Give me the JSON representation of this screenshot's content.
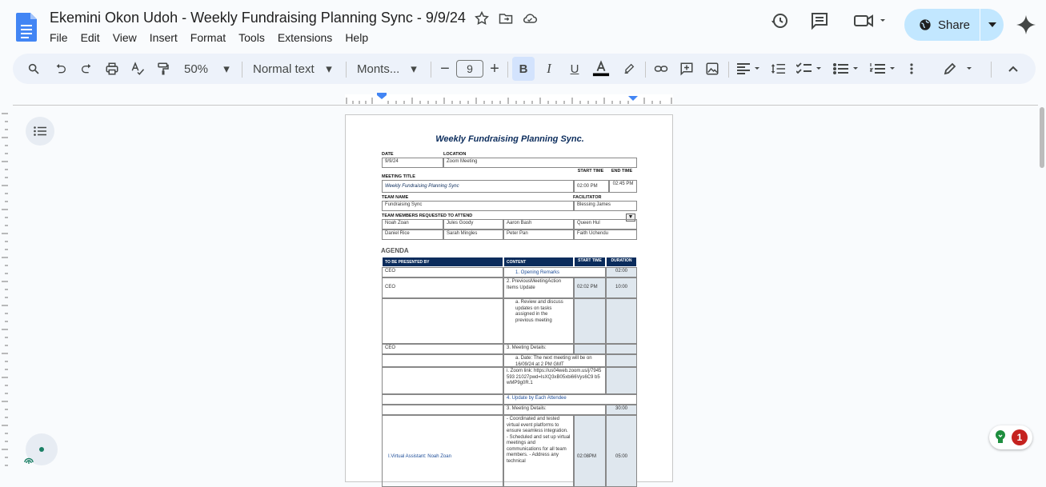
{
  "app": {
    "title": "Ekemini Okon Udoh - Weekly Fundraising Planning Sync - 9/9/24",
    "menus": [
      "File",
      "Edit",
      "View",
      "Insert",
      "Format",
      "Tools",
      "Extensions",
      "Help"
    ],
    "share_label": "Share",
    "notification_count": "1"
  },
  "toolbar": {
    "zoom": "50%",
    "style": "Normal text",
    "font": "Monts...",
    "font_size": "9"
  },
  "colors": {
    "accent": "#c2e7ff",
    "header_navy": "#0b2c5c",
    "shade": "#dfe7ee"
  },
  "doc": {
    "title": "Weekly Fundraising Planning Sync.",
    "labels": {
      "date": "DATE",
      "location": "LOCATION",
      "meeting_title": "MEETING TITLE",
      "start_time": "START TIME",
      "end_time": "END TIME",
      "team_name": "TEAM NAME",
      "facilitator": "FACILITATOR",
      "members": "TEAM MEMBERS REQUESTED TO ATTEND"
    },
    "date": "9/9/24",
    "location": "Zoom Meeting",
    "meeting_title": "Weekly Fundraising Planning Sync",
    "start": "02:00 PM",
    "end": "02:45 PM",
    "team_name": "Fundraising Sync",
    "facilitator": "Blessing James",
    "members": [
      "Noah Zoan",
      "Jules Goody",
      "Aaron Bash",
      "Queen Hul",
      "Daniel Rice",
      "Sarah Mingles",
      "Peter Pan",
      "Faith Uchendu"
    ],
    "agenda_heading": "AGENDA",
    "agenda_headers": [
      "TO BE PRESENTED BY",
      "CONTENT",
      "START TIME",
      "DURATION"
    ],
    "agenda": {
      "r1_by": "CEO",
      "r1_content": "1.     Opening Remarks",
      "r1_dur": "02:00",
      "r2_by": "CEO",
      "r2_content": "2. PreviousMeetingAction Items Update",
      "r2_start": "02:02 PM",
      "r2_dur": "10:00",
      "r3_content": "a.   Review and discuss updates on tasks assigned in the previous meeting",
      "r4_by": "CEO",
      "r4_content": "3. Meeting Details:",
      "r5_content": "a.   Date: The next meeting will be on 16/09/24 at 2 PM GMT",
      "r6_content": "i. Zoom link: https://us04web.zoom.us/j/7945593 21027pwd=IsXQ3xB05xbi66Vys6C9 b5wMP9g0R.1",
      "r7_content": "4. Update by Each Attendee",
      "r8_content": "3. Meeting Details:",
      "r8_dur": "30:00",
      "r9_by": "I.Virtual Assistant: Noah Zoan",
      "r9_content": "- Coordinated and tested virtual event platforms to ensure seamless integration. - Scheduled and set up virtual meetings and communications for all team members. - Address any technical",
      "r9_start": "02:08PM",
      "r9_dur": "05:00"
    }
  }
}
